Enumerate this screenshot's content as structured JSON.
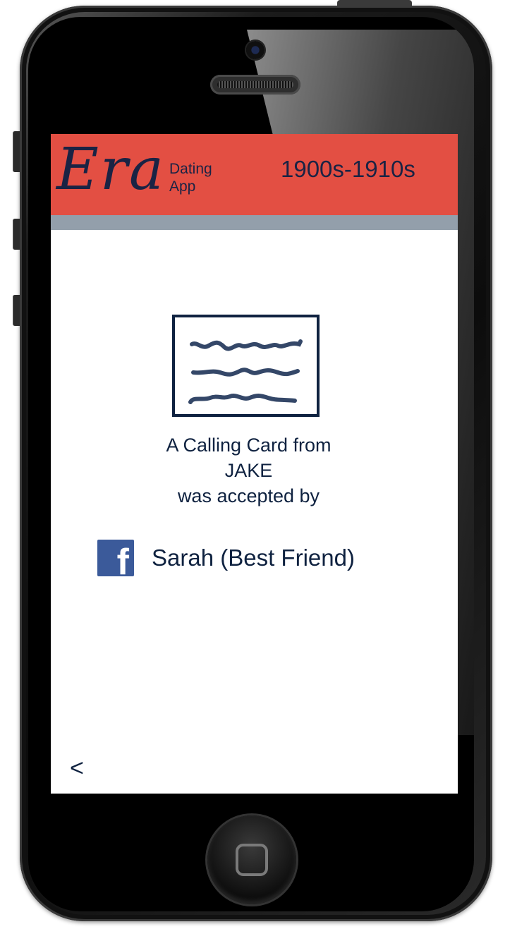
{
  "app": {
    "logo_text": "Era",
    "logo_subtitle_line1": "Dating",
    "logo_subtitle_line2": "App",
    "era_range": "1900s-1910s"
  },
  "card": {
    "icon": "calling-card-icon",
    "line1": "A Calling Card from",
    "sender": "JAKE",
    "line3": "was accepted by"
  },
  "acceptor": {
    "icon": "facebook-icon",
    "icon_glyph": "f",
    "name": "Sarah (Best Friend)"
  },
  "nav": {
    "back_label": "<"
  },
  "colors": {
    "header_bg": "#e34f43",
    "subbar_bg": "#939fab",
    "navy_text": "#0f2240",
    "facebook_blue": "#3b5a9a"
  }
}
